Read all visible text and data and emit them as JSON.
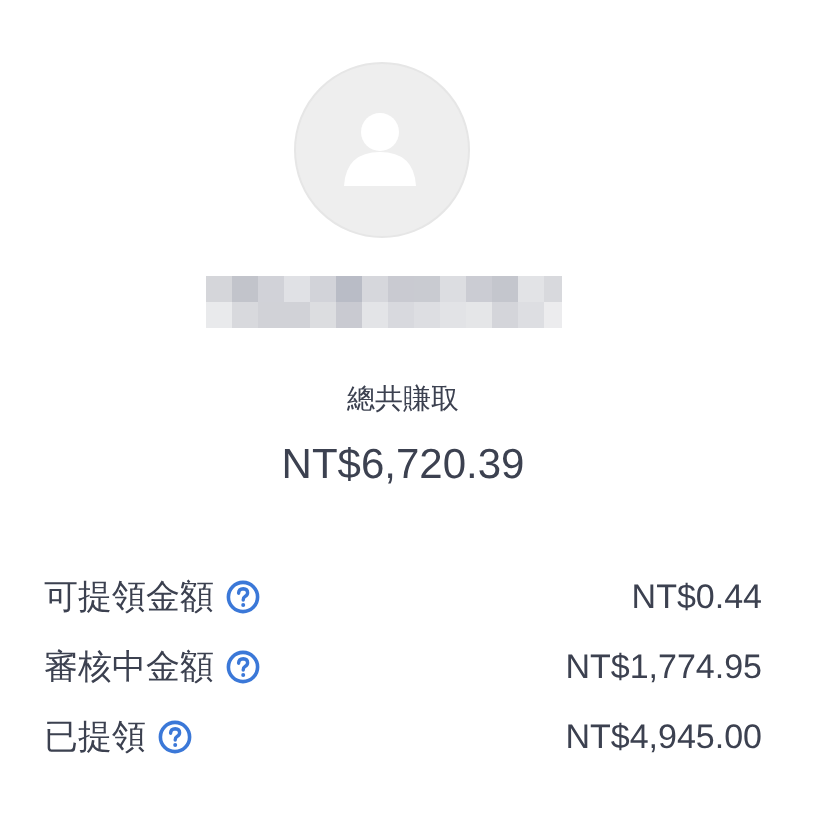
{
  "profile": {
    "avatar": {
      "kind": "placeholder"
    },
    "name": {
      "kind": "redacted"
    }
  },
  "total": {
    "label": "總共賺取",
    "amount": "NT$6,720.39"
  },
  "balances": [
    {
      "label": "可提領金額",
      "amount": "NT$0.44",
      "help": true
    },
    {
      "label": "審核中金額",
      "amount": "NT$1,774.95",
      "help": true
    },
    {
      "label": "已提領",
      "amount": "NT$4,945.00",
      "help": true
    }
  ]
}
